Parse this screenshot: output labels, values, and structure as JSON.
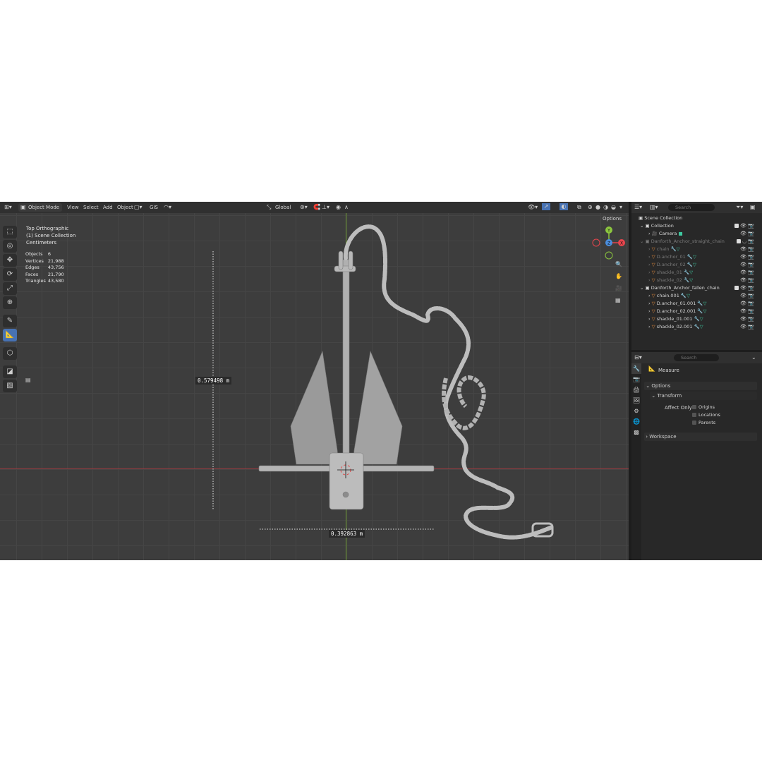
{
  "viewport": {
    "header": {
      "mode": "Object Mode",
      "menu": [
        "View",
        "Select",
        "Add",
        "Object"
      ],
      "addon": "GIS",
      "orientation": "Global",
      "options_label": "Options"
    },
    "overlay": {
      "view_name": "Top Orthographic",
      "collection": "(1) Scene Collection",
      "units": "Centimeters"
    },
    "stats": [
      {
        "label": "Objects",
        "value": "6"
      },
      {
        "label": "Vertices",
        "value": "21,988"
      },
      {
        "label": "Edges",
        "value": "43,756"
      },
      {
        "label": "Faces",
        "value": "21,790"
      },
      {
        "label": "Triangles",
        "value": "43,580"
      }
    ],
    "measurements": {
      "vertical": "0.579498 m",
      "horizontal": "0.392863 m"
    },
    "gizmo": {
      "y": "Y",
      "z": "Z",
      "x": "X"
    }
  },
  "outliner": {
    "search_placeholder": "Search",
    "rows": [
      {
        "label": "Scene Collection",
        "indent": 0,
        "kind": "scene",
        "dim": false
      },
      {
        "label": "Collection",
        "indent": 1,
        "kind": "collection",
        "dim": false
      },
      {
        "label": "Camera",
        "indent": 2,
        "kind": "camera",
        "dim": false
      },
      {
        "label": "Danforth_Anchor_straight_chain",
        "indent": 1,
        "kind": "collection",
        "dim": true
      },
      {
        "label": "chain",
        "indent": 2,
        "kind": "mesh",
        "dim": true
      },
      {
        "label": "D.anchor_01",
        "indent": 2,
        "kind": "mesh",
        "dim": true
      },
      {
        "label": "D.anchor_02",
        "indent": 2,
        "kind": "mesh",
        "dim": true
      },
      {
        "label": "shackle_01",
        "indent": 2,
        "kind": "mesh",
        "dim": true
      },
      {
        "label": "shackle_02",
        "indent": 2,
        "kind": "mesh",
        "dim": true
      },
      {
        "label": "Danforth_Anchor_fallen_chain",
        "indent": 1,
        "kind": "collection",
        "dim": false
      },
      {
        "label": "chain.001",
        "indent": 2,
        "kind": "mesh",
        "dim": false
      },
      {
        "label": "D.anchor_01.001",
        "indent": 2,
        "kind": "mesh",
        "dim": false
      },
      {
        "label": "D.anchor_02.001",
        "indent": 2,
        "kind": "mesh",
        "dim": false
      },
      {
        "label": "shackle_01.001",
        "indent": 2,
        "kind": "mesh",
        "dim": false
      },
      {
        "label": "shackle_02.001",
        "indent": 2,
        "kind": "mesh",
        "dim": false
      }
    ]
  },
  "properties": {
    "search_placeholder": "Search",
    "tool_name": "Measure",
    "sections": {
      "options": "Options",
      "transform": "Transform",
      "affect_only": "Affect Only",
      "origins": "Origins",
      "locations": "Locations",
      "parents": "Parents",
      "workspace": "Workspace"
    }
  },
  "colors": {
    "active_tool": "#4772b3",
    "axis_x": "#e8454d",
    "axis_y": "#8cc63f",
    "axis_z": "#4a8fe0",
    "object_icon": "#e48b3c",
    "modifier_icon": "#5f8dd3"
  }
}
